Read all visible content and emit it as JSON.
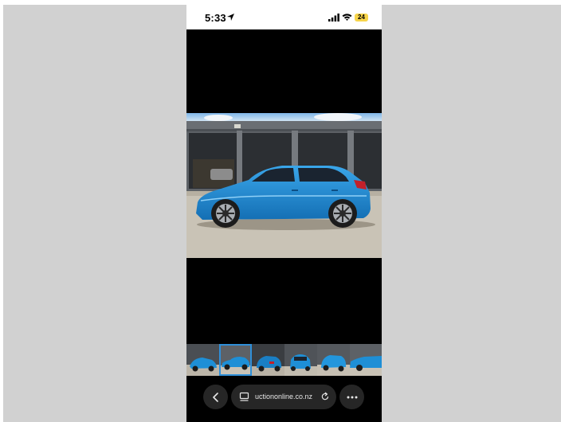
{
  "status_bar": {
    "time": "5:33",
    "battery": "24",
    "location_icon": "location-arrow-icon",
    "signal_icon": "cellular-signal-icon",
    "wifi_icon": "wifi-icon"
  },
  "gallery": {
    "main_photo": "blue-hatchback-photo",
    "selected_thumbnail": 2,
    "thumbnails": [
      {
        "view": "front-three-quarter"
      },
      {
        "view": "side-profile"
      },
      {
        "view": "rear-three-quarter"
      },
      {
        "view": "front"
      },
      {
        "view": "front-three-quarter-angled"
      },
      {
        "view": "side-close"
      }
    ]
  },
  "toolbar": {
    "url": "uctiononline.co.nz",
    "back_icon": "chevron-left-icon",
    "tabs_icon": "tabs-icon",
    "reload_icon": "reload-icon",
    "more_icon": "more-dots-icon"
  },
  "colors": {
    "car_blue": "#1e8fd6",
    "selected_border": "#2f8fd8",
    "toolbar_bg": "#262626",
    "battery_yellow": "#f7d44a"
  }
}
